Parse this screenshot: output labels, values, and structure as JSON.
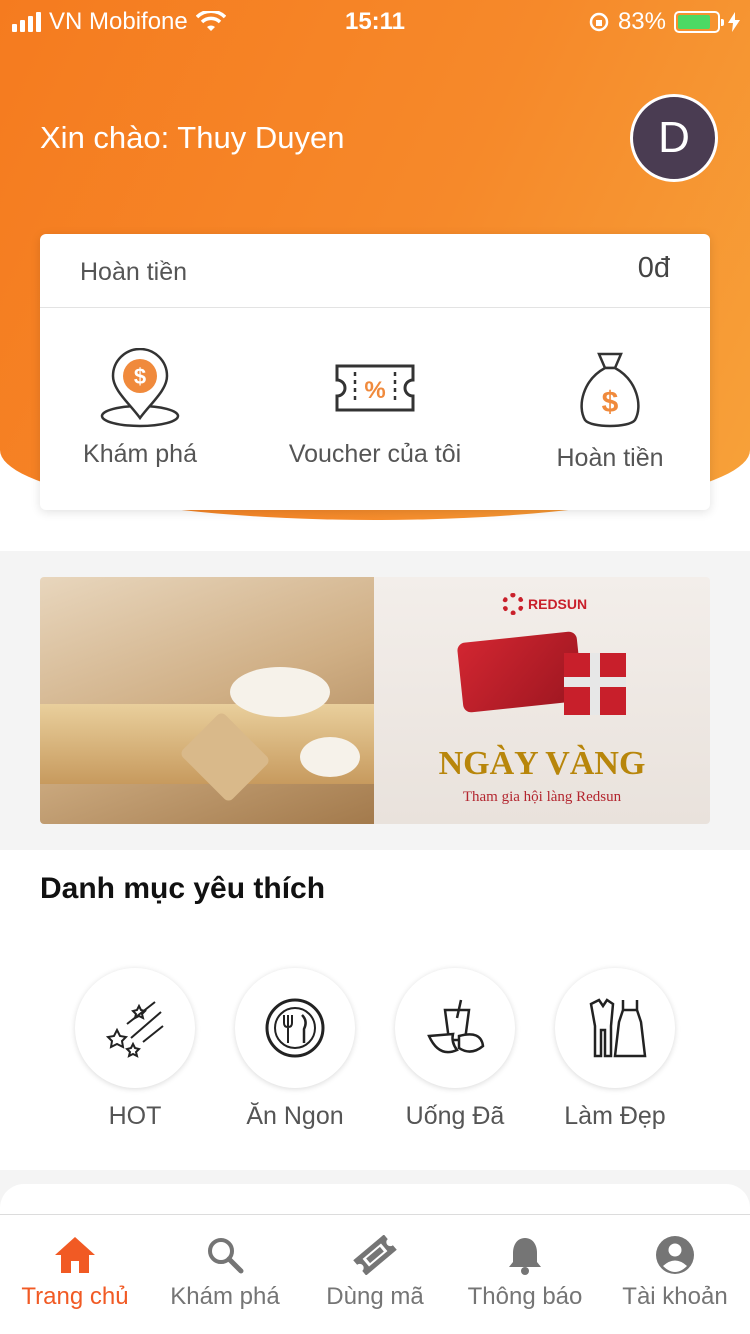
{
  "status_bar": {
    "carrier": "VN Mobifone",
    "time": "15:11",
    "battery_percent": "83%",
    "battery_level": 0.83
  },
  "header": {
    "greeting": "Xin chào: Thuy Duyen",
    "avatar_initial": "D"
  },
  "cashback_card": {
    "label": "Hoàn tiền",
    "amount": "0đ",
    "actions": [
      {
        "label": "Khám phá",
        "icon": "location-coin-icon"
      },
      {
        "label": "Voucher của tôi",
        "icon": "voucher-ticket-icon"
      },
      {
        "label": "Hoàn tiền",
        "icon": "money-bag-icon"
      }
    ]
  },
  "banner": {
    "brand": "REDSUN",
    "title": "NGÀY VÀNG",
    "subtitle": "Tham gia hội làng Redsun"
  },
  "favorites": {
    "title": "Danh mục yêu thích",
    "items": [
      {
        "label": "HOT",
        "icon": "stars-icon"
      },
      {
        "label": "Ăn Ngon",
        "icon": "plate-cutlery-icon"
      },
      {
        "label": "Uống Đã",
        "icon": "drink-fruit-icon"
      },
      {
        "label": "Làm Đẹp",
        "icon": "clothes-icon"
      }
    ]
  },
  "tabbar": {
    "items": [
      {
        "label": "Trang chủ",
        "icon": "home-icon",
        "active": true
      },
      {
        "label": "Khám phá",
        "icon": "search-icon",
        "active": false
      },
      {
        "label": "Dùng mã",
        "icon": "ticket-icon",
        "active": false
      },
      {
        "label": "Thông báo",
        "icon": "bell-icon",
        "active": false
      },
      {
        "label": "Tài khoản",
        "icon": "account-icon",
        "active": false
      }
    ]
  },
  "colors": {
    "accent": "#f15a24",
    "header_orange": "#f6892a",
    "avatar_bg": "#4a3c52",
    "battery_green": "#4cd964"
  }
}
